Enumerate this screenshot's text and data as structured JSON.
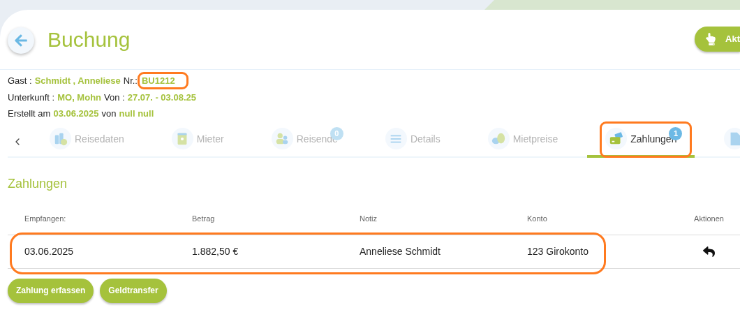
{
  "header": {
    "title": "Buchung",
    "action_button": "Akt"
  },
  "info": [
    [
      {
        "text": "Gast :",
        "kind": "label",
        "highlighted": false
      },
      {
        "text": "Schmidt , Anneliese",
        "kind": "value",
        "highlighted": false
      },
      {
        "text": "Nr.:",
        "kind": "label",
        "highlighted": false
      },
      {
        "text": "BU1212",
        "kind": "value",
        "highlighted": true
      }
    ],
    [
      {
        "text": "Unterkunft :",
        "kind": "label",
        "highlighted": false
      },
      {
        "text": "MO, Mohn",
        "kind": "value",
        "highlighted": false
      },
      {
        "text": "Von :",
        "kind": "label",
        "highlighted": false
      },
      {
        "text": "27.07. - 03.08.25",
        "kind": "value",
        "highlighted": false
      }
    ],
    [
      {
        "text": "Erstellt am",
        "kind": "label",
        "highlighted": false
      },
      {
        "text": "03.06.2025",
        "kind": "value",
        "highlighted": false
      },
      {
        "text": "von",
        "kind": "label",
        "highlighted": false
      },
      {
        "text": "null null",
        "kind": "value",
        "highlighted": false
      }
    ]
  ],
  "tabs": [
    {
      "label": "Reisedaten",
      "selected": false,
      "highlighted": false
    },
    {
      "label": "Mieter",
      "selected": false,
      "highlighted": false
    },
    {
      "label": "Reisende",
      "badge": "0",
      "selected": false,
      "highlighted": false
    },
    {
      "label": "Details",
      "selected": false,
      "highlighted": false
    },
    {
      "label": "Mietpreise",
      "selected": false,
      "highlighted": false
    },
    {
      "label": "Zahlungen",
      "badge": "1",
      "selected": true,
      "highlighted": true
    },
    {
      "selected": false,
      "highlighted": false
    }
  ],
  "section_title": "Zahlungen",
  "table": {
    "columns": [
      "Empfangen:",
      "Betrag",
      "Notiz",
      "Konto",
      "Aktionen"
    ],
    "rows": [
      {
        "cells": [
          "03.06.2025",
          "1.882,50 €",
          "Anneliese Schmidt",
          "123 Girokonto"
        ],
        "highlighted": true
      }
    ]
  },
  "buttons": [
    "Zahlung erfassen",
    "Geldtransfer"
  ]
}
